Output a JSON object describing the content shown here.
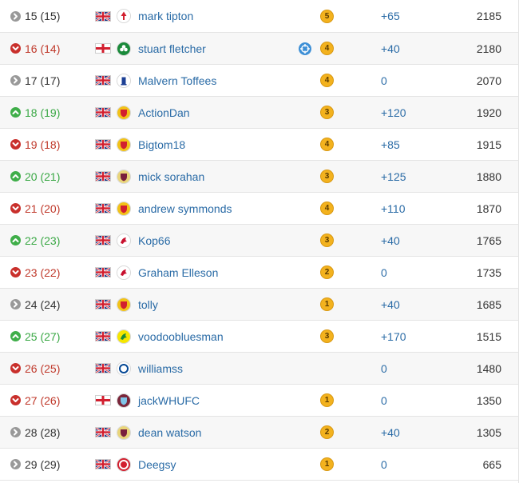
{
  "colors": {
    "link": "#2a6ba6",
    "up": "#3aa845",
    "down": "#c0392b",
    "same": "#333333",
    "level_badge": "#f3b21e"
  },
  "rows": [
    {
      "direction": "same",
      "position": "15 (15)",
      "flag": "uk-flag-icon",
      "crest": "nottingham-forest-crest-icon",
      "name": "mark tipton",
      "badge": "",
      "level": "5",
      "change": "+65",
      "points": "2185"
    },
    {
      "direction": "down",
      "position": "16 (14)",
      "flag": "england-flag-icon",
      "crest": "celtic-crest-icon",
      "name": "stuart fletcher",
      "badge": "target-badge-icon",
      "level": "4",
      "change": "+40",
      "points": "2180"
    },
    {
      "direction": "same",
      "position": "17 (17)",
      "flag": "uk-flag-icon",
      "crest": "everton-crest-icon",
      "name": "Malvern Toffees",
      "badge": "",
      "level": "4",
      "change": "0",
      "points": "2070"
    },
    {
      "direction": "up",
      "position": "18 (19)",
      "flag": "uk-flag-icon",
      "crest": "man-utd-crest-icon",
      "name": "ActionDan",
      "badge": "",
      "level": "3",
      "change": "+120",
      "points": "1920"
    },
    {
      "direction": "down",
      "position": "19 (18)",
      "flag": "uk-flag-icon",
      "crest": "man-utd-crest-icon",
      "name": "Bigtom18",
      "badge": "",
      "level": "4",
      "change": "+85",
      "points": "1915"
    },
    {
      "direction": "up",
      "position": "20 (21)",
      "flag": "uk-flag-icon",
      "crest": "aston-villa-crest-icon",
      "name": "mick sorahan",
      "badge": "",
      "level": "3",
      "change": "+125",
      "points": "1880"
    },
    {
      "direction": "down",
      "position": "21 (20)",
      "flag": "uk-flag-icon",
      "crest": "man-utd-crest-icon",
      "name": "andrew symmonds",
      "badge": "",
      "level": "4",
      "change": "+110",
      "points": "1870"
    },
    {
      "direction": "up",
      "position": "22 (23)",
      "flag": "uk-flag-icon",
      "crest": "liverpool-crest-icon",
      "name": "Kop66",
      "badge": "",
      "level": "3",
      "change": "+40",
      "points": "1765"
    },
    {
      "direction": "down",
      "position": "23 (22)",
      "flag": "uk-flag-icon",
      "crest": "liverpool-crest-icon",
      "name": "Graham Elleson",
      "badge": "",
      "level": "2",
      "change": "0",
      "points": "1735"
    },
    {
      "direction": "same",
      "position": "24 (24)",
      "flag": "uk-flag-icon",
      "crest": "man-utd-crest-icon",
      "name": "tolly",
      "badge": "",
      "level": "1",
      "change": "+40",
      "points": "1685"
    },
    {
      "direction": "up",
      "position": "25 (27)",
      "flag": "uk-flag-icon",
      "crest": "norwich-crest-icon",
      "name": "voodoobluesman",
      "badge": "",
      "level": "3",
      "change": "+170",
      "points": "1515"
    },
    {
      "direction": "down",
      "position": "26 (25)",
      "flag": "uk-flag-icon",
      "crest": "chelsea-crest-icon",
      "name": "williamss",
      "badge": "",
      "level": "",
      "change": "0",
      "points": "1480"
    },
    {
      "direction": "down",
      "position": "27 (26)",
      "flag": "england-flag-icon",
      "crest": "west-ham-crest-icon",
      "name": "jackWHUFC",
      "badge": "",
      "level": "1",
      "change": "0",
      "points": "1350"
    },
    {
      "direction": "same",
      "position": "28 (28)",
      "flag": "uk-flag-icon",
      "crest": "aston-villa-crest-icon",
      "name": "dean watson",
      "badge": "",
      "level": "2",
      "change": "+40",
      "points": "1305"
    },
    {
      "direction": "same",
      "position": "29 (29)",
      "flag": "uk-flag-icon",
      "crest": "aberdeen-crest-icon",
      "name": "Deegsy",
      "badge": "",
      "level": "1",
      "change": "0",
      "points": "665"
    }
  ]
}
